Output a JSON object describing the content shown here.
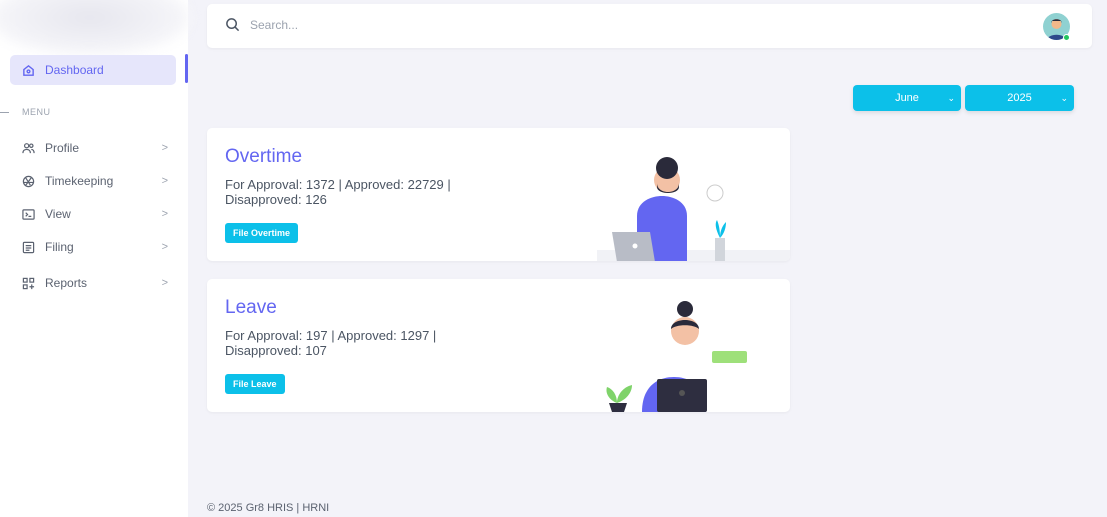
{
  "sidebar": {
    "dashboard": "Dashboard",
    "menu_label": "MENU",
    "items": [
      {
        "label": "Profile",
        "icon": "users-icon"
      },
      {
        "label": "Timekeeping",
        "icon": "aperture-icon"
      },
      {
        "label": "View",
        "icon": "terminal-icon"
      },
      {
        "label": "Filing",
        "icon": "document-icon"
      },
      {
        "label": "Reports",
        "icon": "grid-plus-icon"
      }
    ]
  },
  "header": {
    "search_placeholder": "Search..."
  },
  "filters": {
    "month": "June",
    "year": "2025"
  },
  "cards": [
    {
      "title": "Overtime",
      "stats": "For Approval: 1372 | Approved: 22729 | Disapproved: 126",
      "button": "File Overtime"
    },
    {
      "title": "Leave",
      "stats": "For Approval: 197 | Approved: 1297 | Disapproved: 107",
      "button": "File Leave"
    }
  ],
  "footer": "© 2025 Gr8 HRIS | HRNI",
  "colors": {
    "accent": "#6366f1",
    "button": "#0cc0e9"
  }
}
